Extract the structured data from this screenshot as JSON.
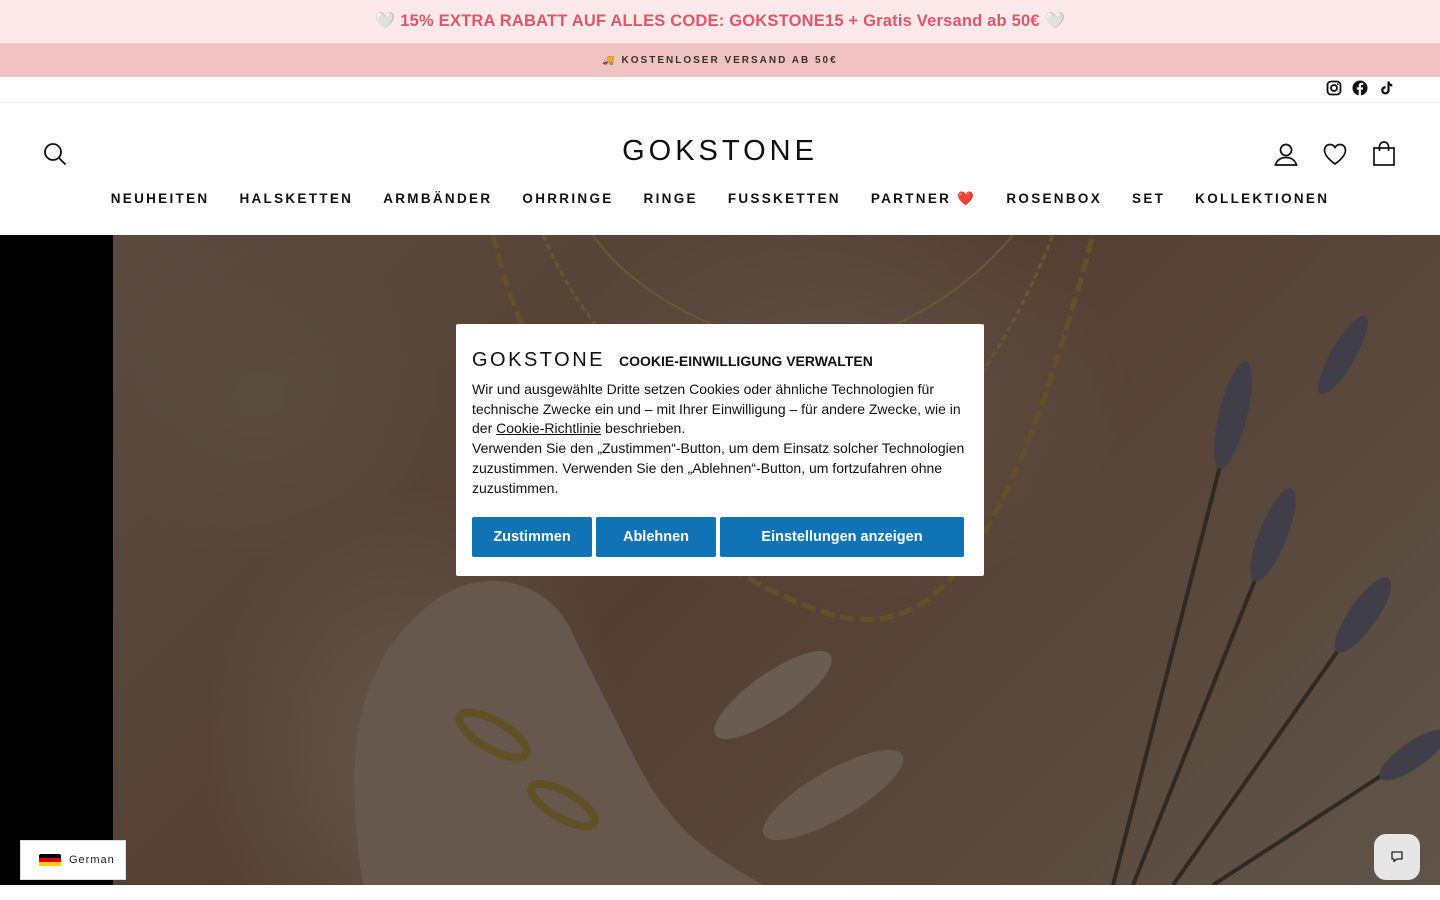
{
  "promo": {
    "text": "🤍 15% EXTRA RABATT AUF ALLES CODE: GOKSTONE15 + Gratis Versand ab 50€ 🤍"
  },
  "shipping": {
    "text": "🚚 KOSTENLOSER VERSAND AB 50€"
  },
  "social": [
    "instagram-icon",
    "facebook-icon",
    "tiktok-icon"
  ],
  "header": {
    "logo": "GOKSTONE",
    "icons": [
      "search-icon",
      "account-icon",
      "wishlist-icon",
      "cart-icon"
    ]
  },
  "nav": {
    "items": [
      {
        "label": "NEUHEITEN"
      },
      {
        "label": "HALSKETTEN"
      },
      {
        "label": "ARMBÄNDER"
      },
      {
        "label": "OHRRINGE"
      },
      {
        "label": "RINGE"
      },
      {
        "label": "FUSSKETTEN"
      },
      {
        "label": "PARTNER ❤️"
      },
      {
        "label": "ROSENBOX"
      },
      {
        "label": "SET"
      },
      {
        "label": "KOLLEKTIONEN"
      }
    ]
  },
  "cookie": {
    "logo": "GOKSTONE",
    "title": "COOKIE-EINWILLIGUNG VERWALTEN",
    "text_before_link": "Wir und ausgewählte Dritte setzen Cookies oder ähnliche Technologien für technische Zwecke ein und – mit Ihrer Einwilligung – für andere Zwecke, wie in der ",
    "link": "Cookie-Richtlinie",
    "text_after_link": " beschrieben.",
    "text_second": "Verwenden Sie den „Zustimmen“-Button, um dem Einsatz solcher Technologien zuzustimmen. Verwenden Sie den „Ablehnen“-Button, um fortzufahren ohne zuzustimmen.",
    "accept": "Zustimmen",
    "reject": "Ablehnen",
    "settings": "Einstellungen anzeigen",
    "button_color": "#0f73b6"
  },
  "language": {
    "label": "German"
  },
  "colors": {
    "promo_bg": "#fde8ea",
    "promo_text": "#e0566a",
    "shipping_bg": "#f1c2c2"
  }
}
